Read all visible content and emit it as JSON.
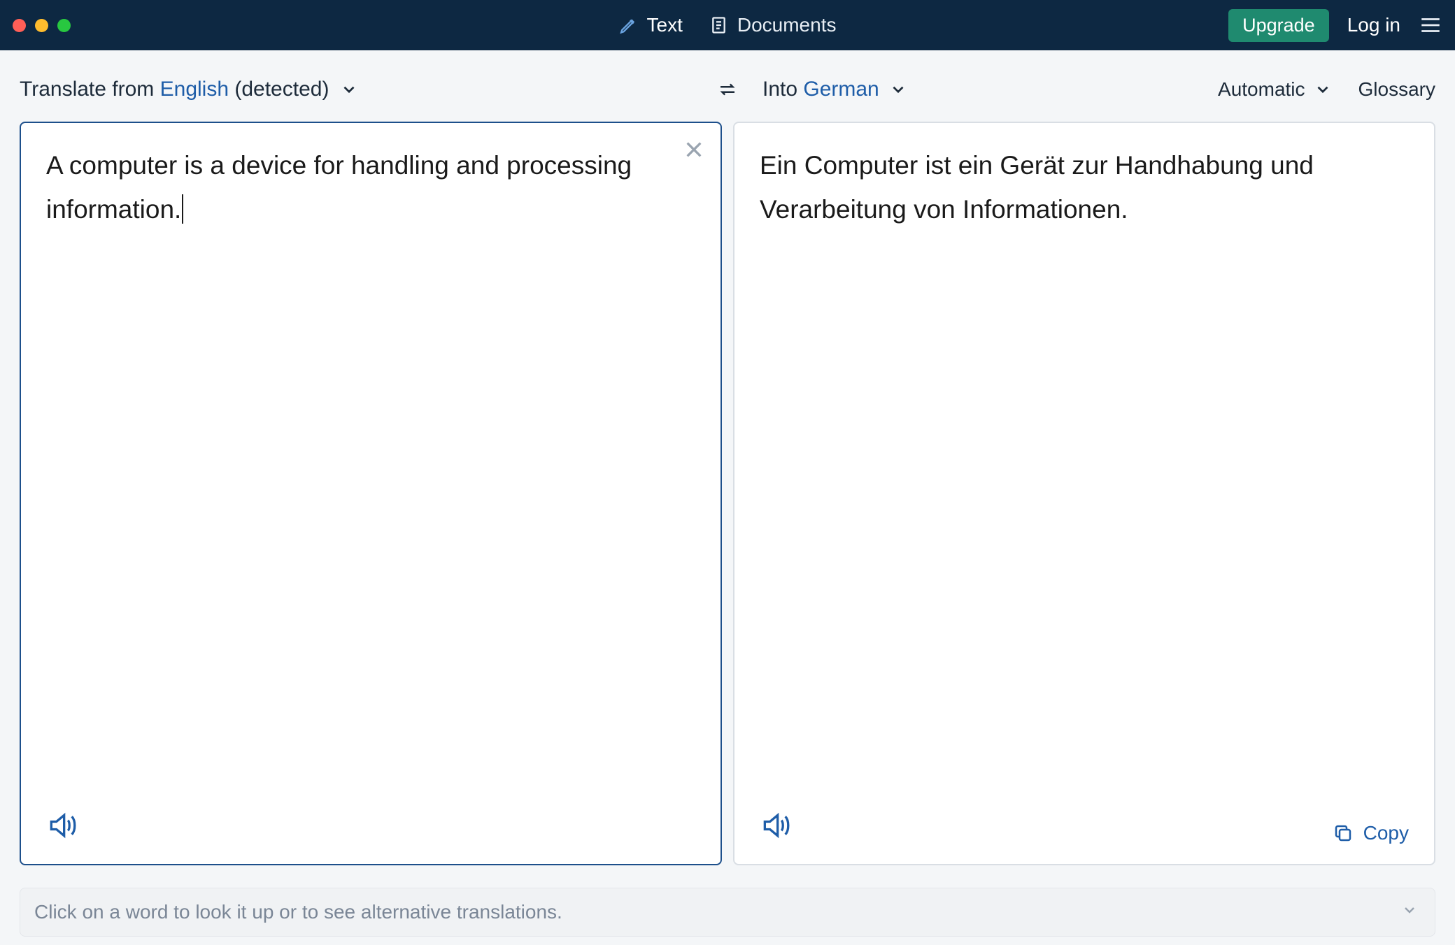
{
  "titlebar": {
    "tabs": {
      "text": "Text",
      "documents": "Documents"
    },
    "upgrade": "Upgrade",
    "login": "Log in"
  },
  "controls": {
    "from_prefix": "Translate from ",
    "from_lang": "English",
    "detected": " (detected)",
    "into_prefix": "Into ",
    "into_lang": "German",
    "automatic": "Automatic",
    "glossary": "Glossary"
  },
  "panels": {
    "source_text": "A computer is a device for handling and processing information.",
    "target_text": "Ein Computer ist ein Gerät zur Handhabung und Verarbeitung von Informationen.",
    "copy": "Copy"
  },
  "hint": "Click on a word to look it up or to see alternative translations."
}
